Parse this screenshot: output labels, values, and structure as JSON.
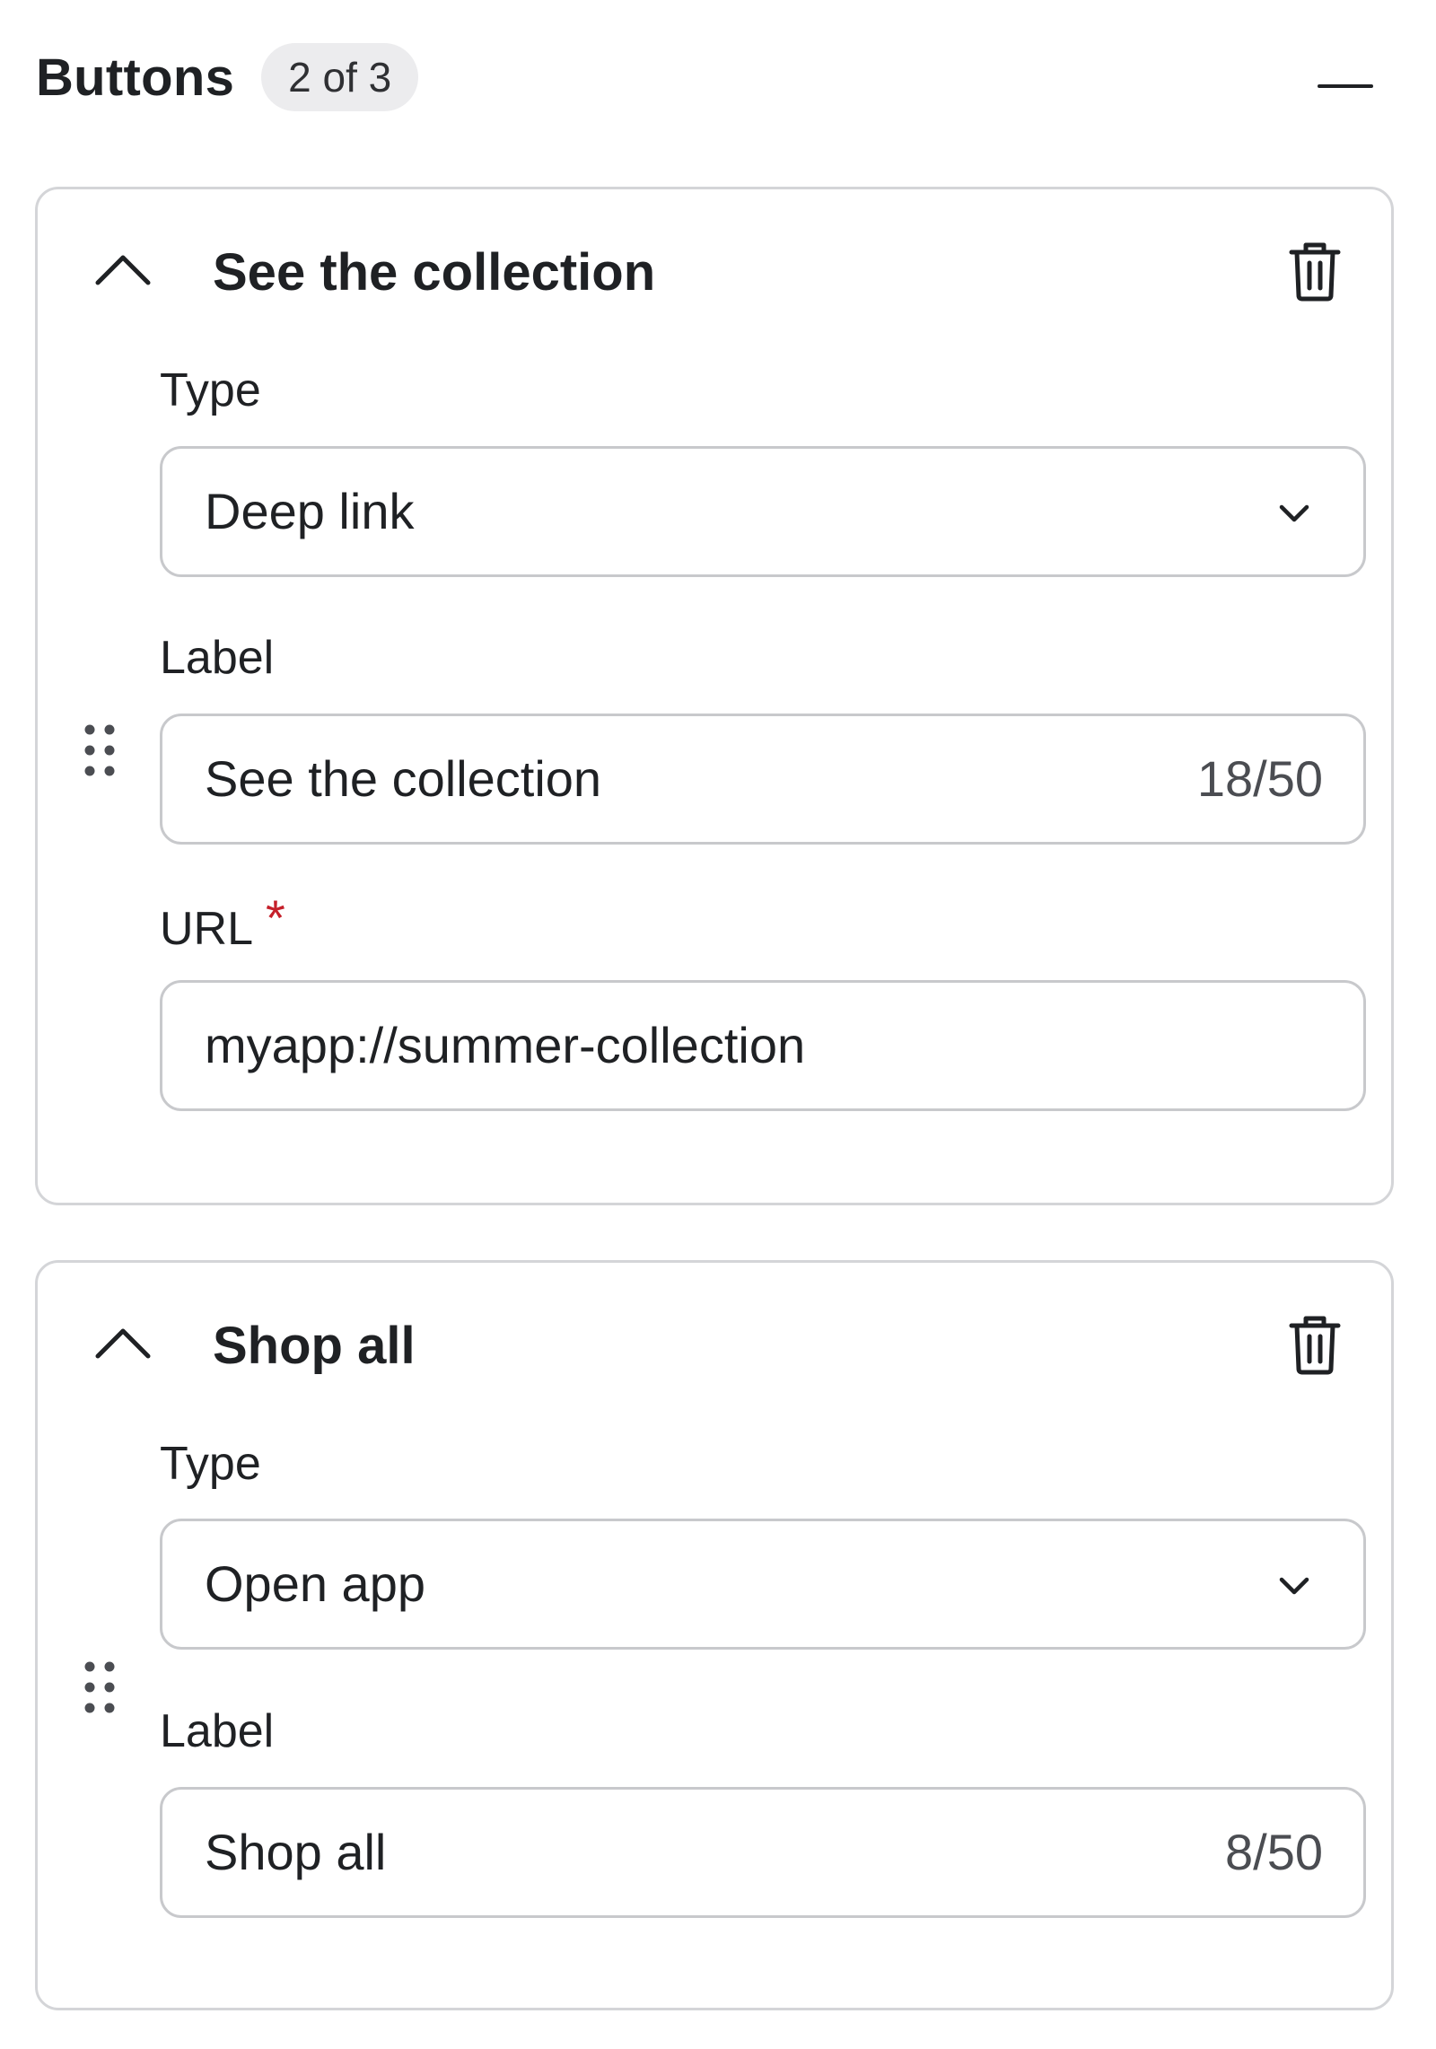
{
  "header": {
    "title": "Buttons",
    "count_badge": "2 of 3",
    "collapse_icon": "minus-icon"
  },
  "buttons": [
    {
      "title": "See the collection",
      "type_label": "Type",
      "type_value": "Deep link",
      "label_label": "Label",
      "label_value": "See the collection",
      "label_counter": "18/50",
      "url_label": "URL",
      "url_required_mark": "*",
      "url_value": "myapp://summer-collection"
    },
    {
      "title": "Shop all",
      "type_label": "Type",
      "type_value": "Open app",
      "label_label": "Label",
      "label_value": "Shop all",
      "label_counter": "8/50"
    }
  ],
  "icons": {
    "expand_toggle": "chevron-up-icon",
    "delete": "trash-icon",
    "drag": "drag-handle-icon",
    "select": "chevron-down-icon"
  },
  "colors": {
    "required": "#c5202a",
    "border": "#d4d5d8",
    "badge_bg": "#ececee",
    "text": "#1f2124"
  }
}
